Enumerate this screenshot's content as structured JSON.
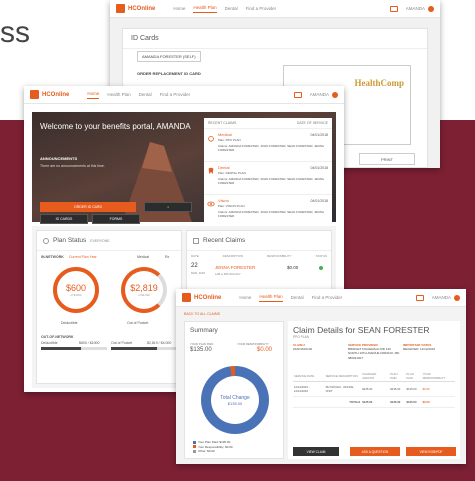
{
  "bg_text": "ss",
  "nav": {
    "logo": "HCOnline",
    "items": [
      "Home",
      "Health Plan",
      "Dental",
      "Find a Provider"
    ],
    "user": "AMANDA"
  },
  "id_cards": {
    "title": "ID Cards",
    "member_select": "AMANDA FORESTER (SELF)",
    "replace_label": "ORDER REPLACEMENT ID CARD",
    "card_logo": "HealthComp",
    "print": "PRINT"
  },
  "dashboard": {
    "welcome": "Welcome to your benefits portal, AMANDA",
    "announcements_label": "ANNOUNCEMENTS",
    "announcement_text": "There are no announcements at this time.",
    "recent_header": "RECENT CLAIMS",
    "claim_date_header": "DATE OF SERVICE",
    "order_card": "ORDER ID CARD",
    "id_cards_btn": "ID CARDS",
    "forms_btn": "FORMS",
    "claims": [
      {
        "type": "Medical",
        "date": "04/01/2018",
        "plan": "Plan: PPO PLAN",
        "claims": "Claims: AMANDA FORESTER, JOHN FORESTER, SEAN FORESTER, JENNA FORESTER"
      },
      {
        "type": "Dental",
        "date": "04/01/2018",
        "plan": "Plan: DENTAL PLAN",
        "claims": "Claims: AMANDA FORESTER, JOHN FORESTER, SEAN FORESTER, JENNA FORESTER"
      },
      {
        "type": "Vision",
        "date": "04/01/2018",
        "plan": "Plan: VISION PLAN",
        "claims": "Claims: AMANDA FORESTER, JOHN FORESTER, SEAN FORESTER, JENNA FORESTER"
      }
    ],
    "plan_status": "Plan Status",
    "plan_filter": "EVERYONE",
    "in_network": "IN-NETWORK",
    "current_year": "Current Plan Year",
    "medical": "Medical",
    "rx": "Rx",
    "deductible_value": "$600",
    "deductible_of": "of $1000",
    "deductible_label": "Deductible",
    "oop_value": "$2,819",
    "oop_of": "of $4,000",
    "oop_label": "Out of Pocket",
    "out_network": "OUT-OF-NETWORK",
    "oon_deductible": "Deductible",
    "oon_deductible_val": "$600 / $1000",
    "oon_oop": "Out of Pocket",
    "oon_oop_val": "$2,819 / $4,000",
    "recent_claims": "Recent Claims",
    "rc_headers": [
      "DATE",
      "DESCRIPTION",
      "RESPONSIBILITY",
      "STATUS"
    ],
    "rc_day": "22",
    "rc_month": "MAR, 2018",
    "rc_name": "JENNA FORESTER",
    "rc_amount": "$0.00",
    "rc_desc": "LAB & PATHOLOGY"
  },
  "claim": {
    "back": "BACK TO ALL CLAIMS",
    "summary": "Summary",
    "your_plan_paid_label": "YOUR PLAN PAID",
    "your_plan_paid": "$135.00",
    "your_resp_label": "YOUR RESPONSIBILITY",
    "your_resp": "$0.00",
    "total_change": "Total Change",
    "total_amount": "$135.00",
    "legend": [
      "Your Plan Paid: $135.00",
      "Your Responsibility: $0.00",
      "Other: $0.00"
    ],
    "title": "Claim Details for SEAN FORESTER",
    "plan": "PPO PLAN",
    "col1_title": "CLAIM #",
    "col1_val": "20AF4FF0140",
    "col2_title": "SERVICE PROVIDER",
    "col2_val": "BRIDGET FIGGERALD MD 120 NORTH 10TH AVENUE FRESNO, MD 980021007",
    "col3_title": "IMPORTANT DATES",
    "col3_val": "RECEIVED: 12/12/2016",
    "table_headers": [
      "SERVICE DATE",
      "SERVICE DESCRIPTION",
      "CHARGED AMOUNT",
      "PLAN PAID",
      "PLAN PAID",
      "YOUR RESPONSIBILITY"
    ],
    "row": [
      "12/12/2016 - 12/12/2016",
      "PHYSICIAN - OFFICE VISIT",
      "$135.00",
      "$135.00",
      "$135.00",
      "$0.00"
    ],
    "totals_label": "TOTALS",
    "totals": [
      "$135.00",
      "$135.00",
      "$135.00",
      "$0.00"
    ],
    "btn_view_claim": "VIEW CLAIM",
    "btn_ask": "ASK A QUESTION",
    "btn_eob": "VIEW EOB/PDF"
  },
  "colors": {
    "accent": "#e65c1e",
    "maroon": "#7d2034",
    "blue": "#4a73b7"
  }
}
